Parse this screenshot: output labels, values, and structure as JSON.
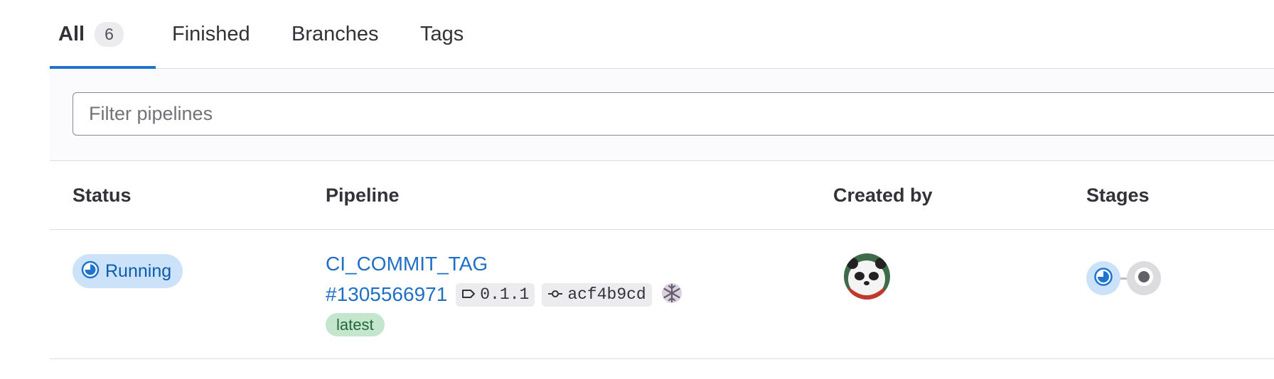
{
  "tabs": [
    {
      "label": "All",
      "count": "6",
      "active": true
    },
    {
      "label": "Finished"
    },
    {
      "label": "Branches"
    },
    {
      "label": "Tags"
    }
  ],
  "filter": {
    "placeholder": "Filter pipelines"
  },
  "table": {
    "headers": [
      "Status",
      "Pipeline",
      "Created by",
      "Stages"
    ],
    "rows": [
      {
        "status": "Running",
        "pipeline_title": "CI_COMMIT_TAG",
        "pipeline_id": "#1305566971",
        "ref": "0.1.1",
        "sha": "acf4b9cd",
        "badge": "latest",
        "creator_avatar": "avatar-panda",
        "stages": [
          "running",
          "created"
        ]
      }
    ]
  },
  "colors": {
    "link": "#1f6fc5",
    "running_bg": "#cbe2f9",
    "running_fg": "#0b5cad",
    "latest_bg": "#c3e6cd",
    "latest_fg": "#24663b",
    "tab_active": "#1f75cb"
  },
  "icons": {
    "status": "status-running-icon",
    "ref": "label-icon",
    "sha": "commit-icon",
    "mirror": "snowflake-icon"
  }
}
